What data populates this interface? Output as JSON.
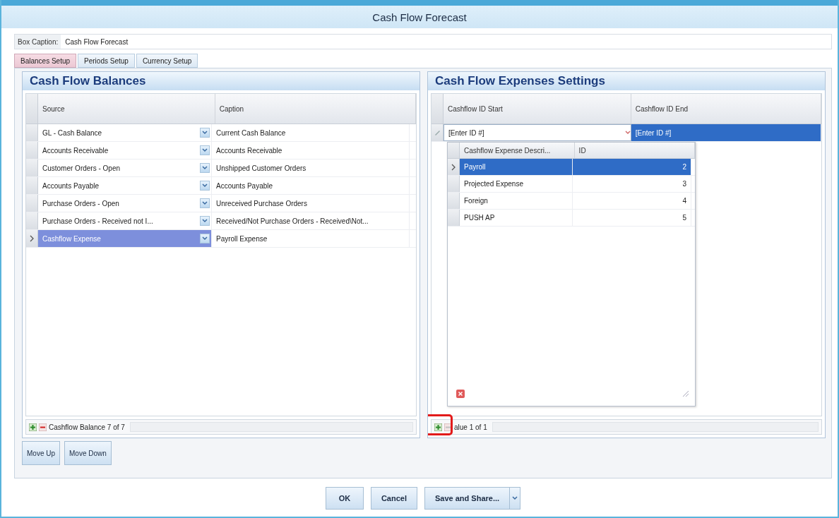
{
  "window": {
    "title": "Cash Flow Forecast"
  },
  "box_caption": {
    "label": "Box Caption:",
    "value": "Cash Flow Forecast"
  },
  "tabs": [
    {
      "label": "Balances Setup",
      "selected": true
    },
    {
      "label": "Periods Setup",
      "selected": false
    },
    {
      "label": "Currency Setup",
      "selected": false
    }
  ],
  "balances_panel": {
    "title": "Cash Flow Balances",
    "columns": [
      "Source",
      "Caption"
    ],
    "rows": [
      {
        "source": "GL - Cash Balance",
        "caption": "Current Cash Balance",
        "selected": false
      },
      {
        "source": "Accounts Receivable",
        "caption": "Accounts Receivable",
        "selected": false
      },
      {
        "source": "Customer Orders - Open",
        "caption": "Unshipped Customer Orders",
        "selected": false
      },
      {
        "source": "Accounts Payable",
        "caption": "Accounts Payable",
        "selected": false
      },
      {
        "source": "Purchase Orders - Open",
        "caption": "Unreceived Purchase Orders",
        "selected": false
      },
      {
        "source": "Purchase Orders - Received not I...",
        "caption": "Received/Not Purchase Orders - Received\\Not...",
        "selected": false
      },
      {
        "source": "Cashflow Expense",
        "caption": "Payroll Expense",
        "selected": true
      }
    ],
    "navigator": {
      "label": "Cashflow Balance 7 of 7",
      "highlighted": false
    }
  },
  "expenses_panel": {
    "title": "Cash Flow Expenses Settings",
    "columns": [
      "Cashflow ID Start",
      "Cashflow ID End"
    ],
    "row": {
      "start": "[Enter ID #]",
      "end": "[Enter ID #]",
      "end_selected": true
    },
    "dropdown": {
      "columns": [
        "Cashflow Expense Descri...",
        "ID"
      ],
      "rows": [
        {
          "description": "Payroll",
          "id": "2",
          "selected": true
        },
        {
          "description": "Projected Expense",
          "id": "3",
          "selected": false
        },
        {
          "description": "Foreign",
          "id": "4",
          "selected": false
        },
        {
          "description": "PUSH AP",
          "id": "5",
          "selected": false
        }
      ]
    },
    "navigator": {
      "label": "alue 1 of 1",
      "highlighted": true
    }
  },
  "move_buttons": [
    "Move Up",
    "Move Down"
  ],
  "buttons": [
    "OK",
    "Cancel",
    "Save and Share..."
  ]
}
